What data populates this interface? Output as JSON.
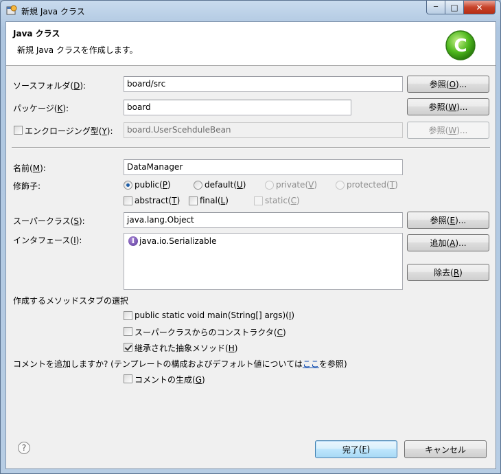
{
  "window": {
    "title": "新規 Java クラス",
    "caption": {
      "minimize": "─",
      "maximize": "□",
      "close": "✕"
    }
  },
  "banner": {
    "title": "Java クラス",
    "description": "新規 Java クラスを作成します。",
    "logo_icon": "eclipse-class-c-icon",
    "logo_letter": "C"
  },
  "source_folder": {
    "label": "ソースフォルダ",
    "mnemonic": "D",
    "value": "board/src",
    "browse": "参照",
    "browse_mnemonic": "O"
  },
  "package": {
    "label": "パッケージ",
    "mnemonic": "K",
    "value": "board",
    "browse": "参照",
    "browse_mnemonic": "W"
  },
  "enclosing": {
    "label": "エンクロージング型",
    "mnemonic": "Y",
    "value": "board.UserScehduleBean",
    "browse": "参照",
    "browse_mnemonic": "W"
  },
  "name": {
    "label": "名前",
    "mnemonic": "M",
    "value": "DataManager"
  },
  "modifiers": {
    "label": "修飾子",
    "public": {
      "text": "public",
      "mnemonic": "P"
    },
    "default": {
      "text": "default",
      "mnemonic": "U"
    },
    "private": {
      "text": "private",
      "mnemonic": "V"
    },
    "protected": {
      "text": "protected",
      "mnemonic": "T"
    },
    "abstract": {
      "text": "abstract",
      "mnemonic": "T"
    },
    "final": {
      "text": "final",
      "mnemonic": "L"
    },
    "static": {
      "text": "static",
      "mnemonic": "C"
    }
  },
  "superclass": {
    "label": "スーパークラス",
    "mnemonic": "S",
    "value": "java.lang.Object",
    "browse": "参照",
    "browse_mnemonic": "E"
  },
  "interfaces": {
    "label": "インタフェース",
    "mnemonic": "I",
    "items": [
      "java.io.Serializable"
    ],
    "add": "追加",
    "add_mnemonic": "A",
    "remove": "除去",
    "remove_mnemonic": "R"
  },
  "stubs": {
    "label": "作成するメソッドスタブの選択",
    "main": {
      "text": "public static void main(String[] args)",
      "mnemonic": "I",
      "checked": false
    },
    "constructors": {
      "text": "スーパークラスからのコンストラクタ",
      "mnemonic": "C",
      "checked": false
    },
    "inherited": {
      "text": "継承された抽象メソッド",
      "mnemonic": "H",
      "checked": true
    }
  },
  "comments": {
    "question_before": "コメントを追加しますか? (テンプレートの構成およびデフォルト値については",
    "link": "ここ",
    "question_after": "を参照)",
    "generate": {
      "text": "コメントの生成",
      "mnemonic": "G",
      "checked": false
    }
  },
  "footer": {
    "help_icon": "help-question-icon",
    "help_glyph": "?",
    "finish": "完了",
    "finish_mnemonic": "F",
    "cancel": "キャンセル"
  }
}
